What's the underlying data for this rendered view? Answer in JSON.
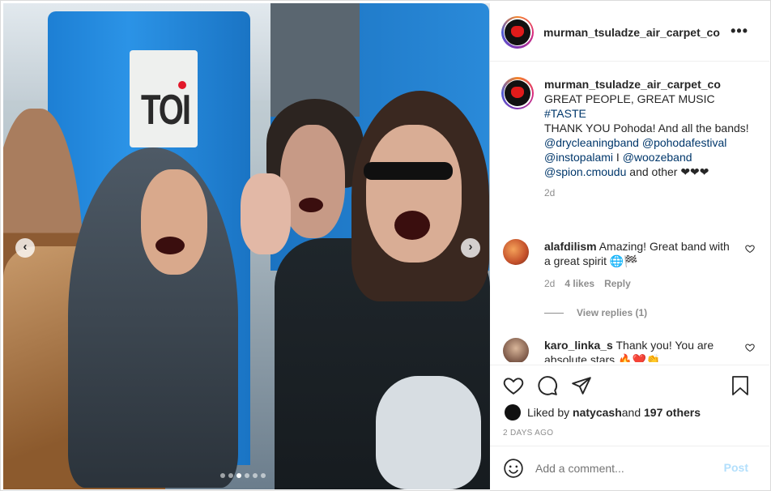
{
  "post": {
    "username": "murman_tsuladze_air_carpet_co",
    "more_icon": "ellipsis-icon"
  },
  "photo": {
    "sign_text": "TOI",
    "carousel": {
      "total": 6,
      "active": 3
    }
  },
  "caption": {
    "username": "murman_tsuladze_air_carpet_co",
    "line1": "GREAT PEOPLE, GREAT MUSIC",
    "hashtag": "#TASTE",
    "line3": "THANK YOU Pohoda! And all the bands!",
    "mention1": "@drycleaningband",
    "mention2": "@pohodafestival",
    "mention3": "@instopalami",
    "sep": " I ",
    "mention4": "@woozeband",
    "mention5": "@spion.cmoudu",
    "tail": " and other ❤❤❤",
    "time": "2d"
  },
  "comments": [
    {
      "username": "alafdilism",
      "text": " Amazing! Great band with a great spirit 🌐🏁",
      "time": "2d",
      "likes": "4 likes",
      "reply": "Reply",
      "view_replies": "View replies (1)"
    },
    {
      "username": "karo_linka_s",
      "text": " Thank you! You are absolute stars 🔥❤️👏"
    }
  ],
  "likes": {
    "prefix": "Liked by ",
    "user": "natycash",
    "middle": " and ",
    "others": "197 others"
  },
  "posted_ago": "2 DAYS AGO",
  "add_comment": {
    "placeholder": "Add a comment...",
    "post_label": "Post"
  },
  "colors": {
    "link": "#00376b",
    "muted": "#8e8e8e",
    "post_disabled": "#b2dffc"
  }
}
